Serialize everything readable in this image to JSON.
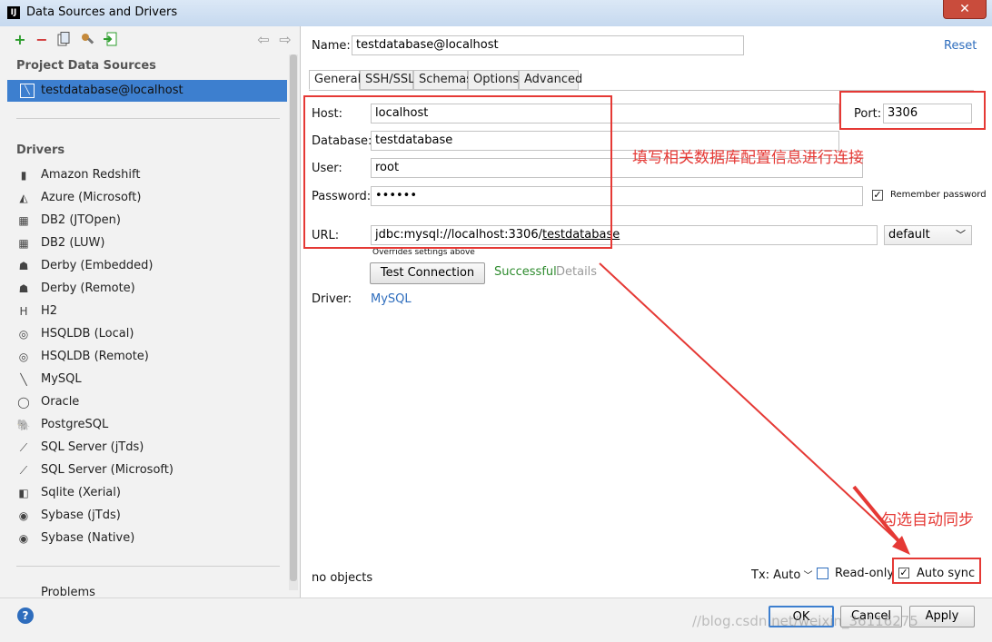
{
  "window": {
    "title": "Data Sources and Drivers",
    "app_icon": "IJ",
    "close_glyph": "✕"
  },
  "left": {
    "project_title": "Project Data Sources",
    "data_source": "testdatabase@localhost",
    "drivers_title": "Drivers",
    "drivers": [
      {
        "label": "Amazon Redshift",
        "icon": "redshift-icon"
      },
      {
        "label": "Azure (Microsoft)",
        "icon": "azure-icon"
      },
      {
        "label": "DB2 (JTOpen)",
        "icon": "db2-icon"
      },
      {
        "label": "DB2 (LUW)",
        "icon": "db2-icon"
      },
      {
        "label": "Derby (Embedded)",
        "icon": "derby-icon"
      },
      {
        "label": "Derby (Remote)",
        "icon": "derby-icon"
      },
      {
        "label": "H2",
        "icon": "h2-icon"
      },
      {
        "label": "HSQLDB (Local)",
        "icon": "hsqldb-icon"
      },
      {
        "label": "HSQLDB (Remote)",
        "icon": "hsqldb-icon"
      },
      {
        "label": "MySQL",
        "icon": "mysql-icon"
      },
      {
        "label": "Oracle",
        "icon": "oracle-icon"
      },
      {
        "label": "PostgreSQL",
        "icon": "postgresql-icon"
      },
      {
        "label": "SQL Server (jTds)",
        "icon": "sqlserver-icon"
      },
      {
        "label": "SQL Server (Microsoft)",
        "icon": "sqlserver-icon"
      },
      {
        "label": "Sqlite (Xerial)",
        "icon": "sqlite-icon"
      },
      {
        "label": "Sybase (jTds)",
        "icon": "sybase-icon"
      },
      {
        "label": "Sybase (Native)",
        "icon": "sybase-icon"
      }
    ],
    "problems": "Problems"
  },
  "form": {
    "name_label": "Name:",
    "name_value": "testdatabase@localhost",
    "reset": "Reset",
    "tabs": [
      "General",
      "SSH/SSL",
      "Schemas",
      "Options",
      "Advanced"
    ],
    "host_label": "Host:",
    "host_value": "localhost",
    "port_label": "Port:",
    "port_value": "3306",
    "database_label": "Database:",
    "database_value": "testdatabase",
    "user_label": "User:",
    "user_value": "root",
    "password_label": "Password:",
    "password_value": "••••••",
    "remember_password": "Remember password",
    "url_label": "URL:",
    "url_prefix": "jdbc:mysql://localhost:3306/",
    "url_db": "testdatabase",
    "url_mode": "default",
    "overrides_note": "Overrides settings above",
    "test_connection": "Test Connection",
    "test_status": "Successful",
    "details": "Details",
    "driver_label": "Driver:",
    "driver_value": "MySQL",
    "objects_status": "no objects",
    "tx_mode": "Tx: Auto",
    "read_only": "Read-only",
    "auto_sync": "Auto sync"
  },
  "annotations": {
    "fill_in": "填写相关数据库配置信息进行连接",
    "check_sync": "勾选自动同步"
  },
  "buttons": {
    "ok": "OK",
    "cancel": "Cancel",
    "apply": "Apply",
    "help": "?"
  },
  "watermark": "//blog.csdn.net/weixin_36116275",
  "colors": {
    "selection": "#3d7fcf",
    "annotation_red": "#e53935",
    "success_green": "#2e8b2e",
    "link_blue": "#2e6dbd"
  }
}
